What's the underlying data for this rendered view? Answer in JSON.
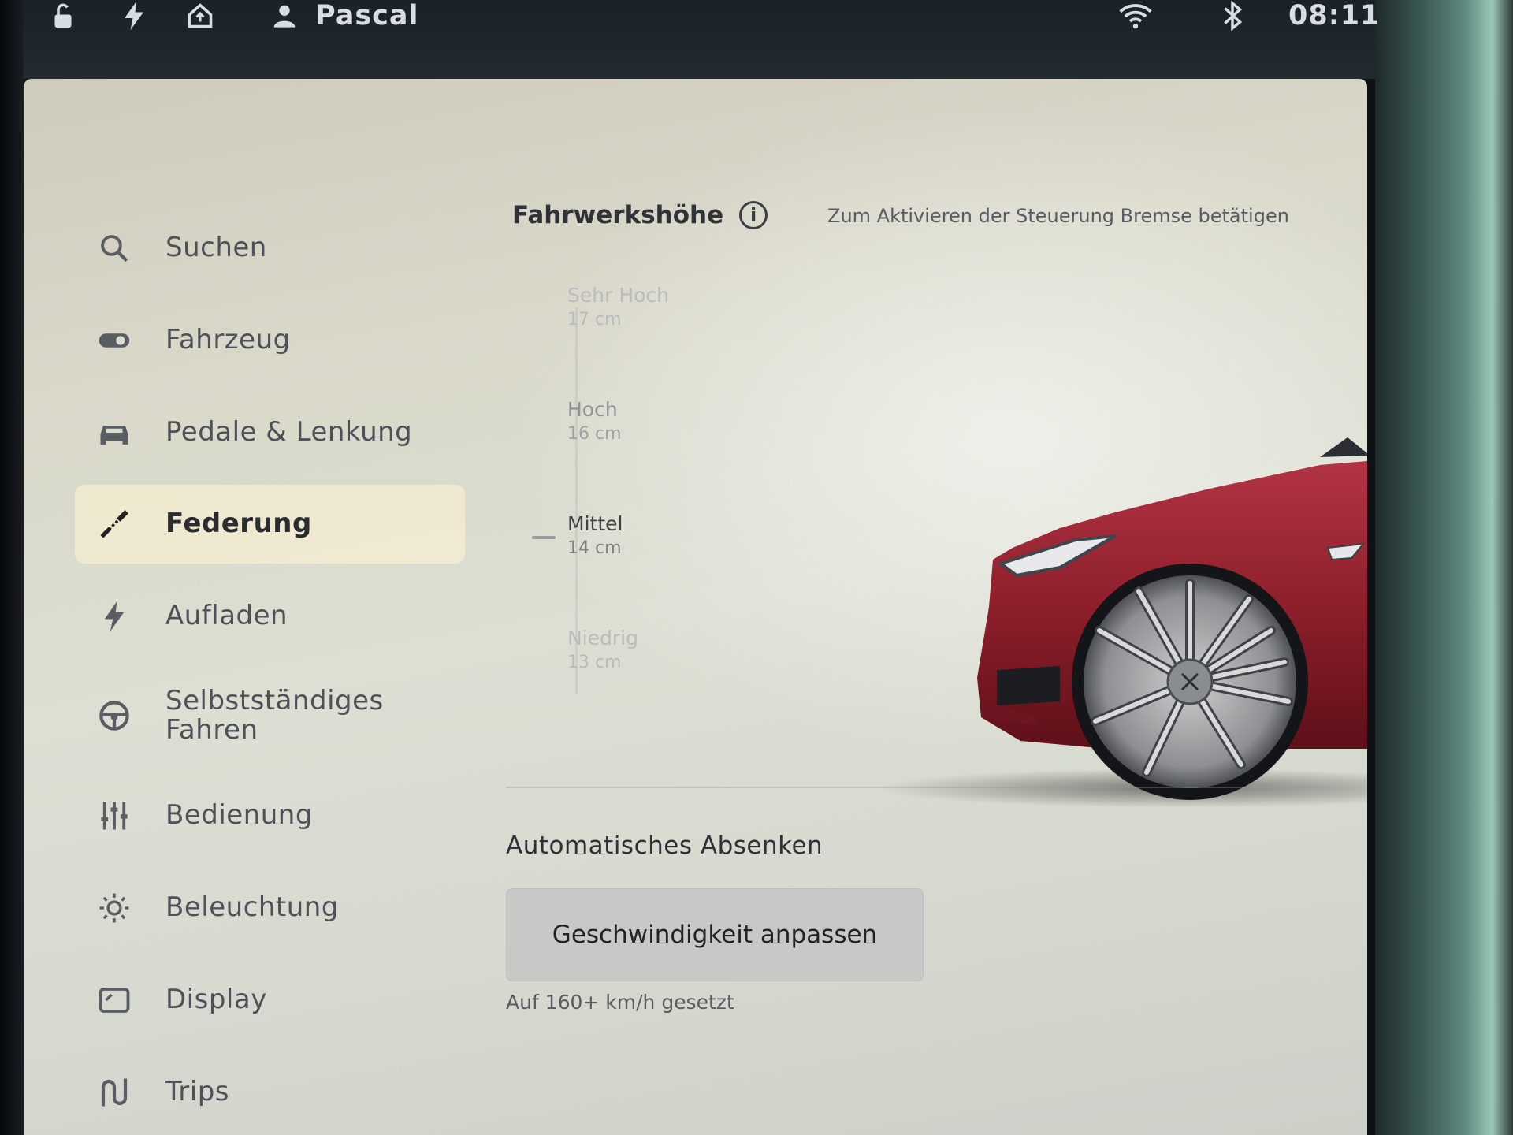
{
  "status_bar": {
    "user_name": "Pascal",
    "time": "08:11",
    "icons": [
      "unlock-icon",
      "bolt-icon",
      "home-icon",
      "user-icon",
      "wifi-icon",
      "bluetooth-icon"
    ]
  },
  "nav": {
    "items": [
      {
        "label": "Suchen",
        "icon": "search-icon"
      },
      {
        "label": "Fahrzeug",
        "icon": "toggle-icon"
      },
      {
        "label": "Pedale & Lenkung",
        "icon": "car-icon"
      },
      {
        "label": "Federung",
        "icon": "suspension-icon",
        "active": true
      },
      {
        "label": "Aufladen",
        "icon": "bolt-icon"
      },
      {
        "label": "Selbstständiges",
        "label2": "Fahren",
        "icon": "steering-wheel-icon"
      },
      {
        "label": "Bedienung",
        "icon": "sliders-icon"
      },
      {
        "label": "Beleuchtung",
        "icon": "sun-icon"
      },
      {
        "label": "Display",
        "icon": "display-icon"
      },
      {
        "label": "Trips",
        "icon": "trips-icon"
      }
    ]
  },
  "ride_height": {
    "title": "Fahrwerkshöhe",
    "hint": "Zum Aktivieren der Steuerung Bremse betätigen",
    "levels": [
      {
        "name": "Sehr Hoch",
        "height": "17 cm"
      },
      {
        "name": "Hoch",
        "height": "16 cm"
      },
      {
        "name": "Mittel",
        "height": "14 cm",
        "selected": true
      },
      {
        "name": "Niedrig",
        "height": "13 cm"
      }
    ]
  },
  "auto_lower": {
    "title": "Automatisches Absenken",
    "button_label": "Geschwindigkeit anpassen",
    "note": "Auf 160+ km/h gesetzt"
  },
  "colors": {
    "car_red": "#8e1f2b",
    "active_bg": "#f3ecd2",
    "text_dark": "#2f3236"
  }
}
